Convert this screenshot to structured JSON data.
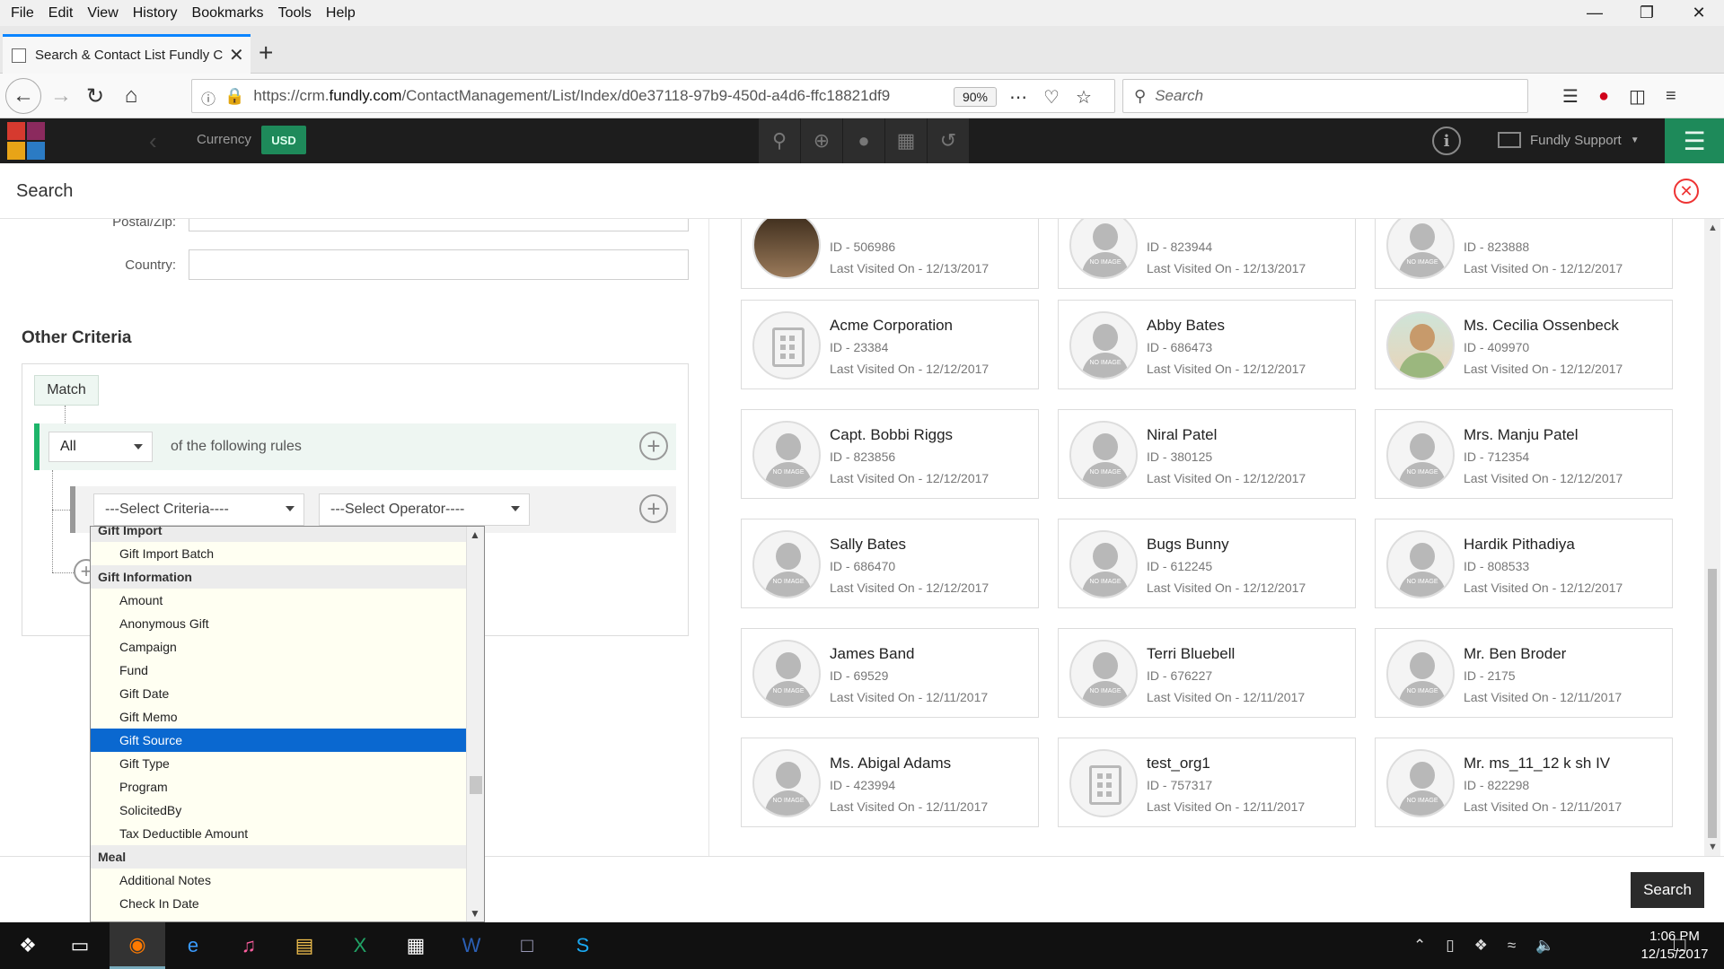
{
  "browser": {
    "menu": [
      "File",
      "Edit",
      "View",
      "History",
      "Bookmarks",
      "Tools",
      "Help"
    ],
    "tab_title": "Search & Contact List Fundly CRM",
    "url_prefix": "https://crm.",
    "url_domain": "fundly.com",
    "url_path": "/ContactManagement/List/Index/d0e37118-97b9-450d-a4d6-ffc18821df9",
    "zoom": "90%",
    "search_placeholder": "Search"
  },
  "app": {
    "currency_label": "Currency",
    "currency_value": "USD",
    "user_name": "Fundly Support"
  },
  "search": {
    "title": "Search",
    "fields": {
      "postal_label": "Postal/Zip:",
      "country_label": "Country:"
    },
    "other_criteria_title": "Other Criteria",
    "match_label": "Match",
    "match_value": "All",
    "following_rules": "of the following rules",
    "criteria_placeholder": "---Select Criteria----",
    "operator_placeholder": "---Select Operator----",
    "dropdown": {
      "items": [
        {
          "type": "group",
          "label": "Gift Import"
        },
        {
          "type": "option",
          "label": "Gift Import Batch"
        },
        {
          "type": "group",
          "label": "Gift Information"
        },
        {
          "type": "option",
          "label": "Amount"
        },
        {
          "type": "option",
          "label": "Anonymous Gift"
        },
        {
          "type": "option",
          "label": "Campaign"
        },
        {
          "type": "option",
          "label": "Fund"
        },
        {
          "type": "option",
          "label": "Gift Date"
        },
        {
          "type": "option",
          "label": "Gift Memo"
        },
        {
          "type": "option",
          "label": "Gift Source",
          "selected": true
        },
        {
          "type": "option",
          "label": "Gift Type"
        },
        {
          "type": "option",
          "label": "Program"
        },
        {
          "type": "option",
          "label": "SolicitedBy"
        },
        {
          "type": "option",
          "label": "Tax Deductible Amount"
        },
        {
          "type": "group",
          "label": "Meal"
        },
        {
          "type": "option",
          "label": "Additional Notes"
        },
        {
          "type": "option",
          "label": "Check In Date"
        }
      ]
    },
    "search_button": "Search"
  },
  "contacts": [
    {
      "name": "",
      "id": "ID - 506986",
      "visited": "Last Visited On - 12/13/2017",
      "avatar": "dark"
    },
    {
      "name": "",
      "id": "ID - 823944",
      "visited": "Last Visited On - 12/13/2017",
      "avatar": "person"
    },
    {
      "name": "",
      "id": "ID - 823888",
      "visited": "Last Visited On - 12/12/2017",
      "avatar": "person"
    },
    {
      "name": "Acme Corporation",
      "id": "ID - 23384",
      "visited": "Last Visited On - 12/12/2017",
      "avatar": "building"
    },
    {
      "name": "Abby Bates",
      "id": "ID - 686473",
      "visited": "Last Visited On - 12/12/2017",
      "avatar": "person"
    },
    {
      "name": "Ms. Cecilia Ossenbeck",
      "id": "ID - 409970",
      "visited": "Last Visited On - 12/12/2017",
      "avatar": "photo"
    },
    {
      "name": "Capt. Bobbi Riggs",
      "id": "ID - 823856",
      "visited": "Last Visited On - 12/12/2017",
      "avatar": "person"
    },
    {
      "name": "Niral Patel",
      "id": "ID - 380125",
      "visited": "Last Visited On - 12/12/2017",
      "avatar": "person"
    },
    {
      "name": "Mrs. Manju Patel",
      "id": "ID - 712354",
      "visited": "Last Visited On - 12/12/2017",
      "avatar": "person"
    },
    {
      "name": "Sally Bates",
      "id": "ID - 686470",
      "visited": "Last Visited On - 12/12/2017",
      "avatar": "person"
    },
    {
      "name": "Bugs Bunny",
      "id": "ID - 612245",
      "visited": "Last Visited On - 12/12/2017",
      "avatar": "person"
    },
    {
      "name": "Hardik Pithadiya",
      "id": "ID - 808533",
      "visited": "Last Visited On - 12/12/2017",
      "avatar": "person"
    },
    {
      "name": "James Band",
      "id": "ID - 69529",
      "visited": "Last Visited On - 12/11/2017",
      "avatar": "person"
    },
    {
      "name": "Terri Bluebell",
      "id": "ID - 676227",
      "visited": "Last Visited On - 12/11/2017",
      "avatar": "person"
    },
    {
      "name": "Mr. Ben Broder",
      "id": "ID - 2175",
      "visited": "Last Visited On - 12/11/2017",
      "avatar": "person"
    },
    {
      "name": "Ms. Abigal Adams",
      "id": "ID - 423994",
      "visited": "Last Visited On - 12/11/2017",
      "avatar": "person"
    },
    {
      "name": "test_org1",
      "id": "ID - 757317",
      "visited": "Last Visited On - 12/11/2017",
      "avatar": "building"
    },
    {
      "name": "Mr. ms_11_12 k sh IV",
      "id": "ID - 822298",
      "visited": "Last Visited On - 12/11/2017",
      "avatar": "person"
    }
  ],
  "no_image_text": "NO IMAGE",
  "taskbar": {
    "time": "1:06 PM",
    "date": "12/15/2017"
  },
  "colors": {
    "accent_green": "#1e8a5a",
    "selected_blue": "#0a68d0",
    "close_red": "#e33333"
  }
}
